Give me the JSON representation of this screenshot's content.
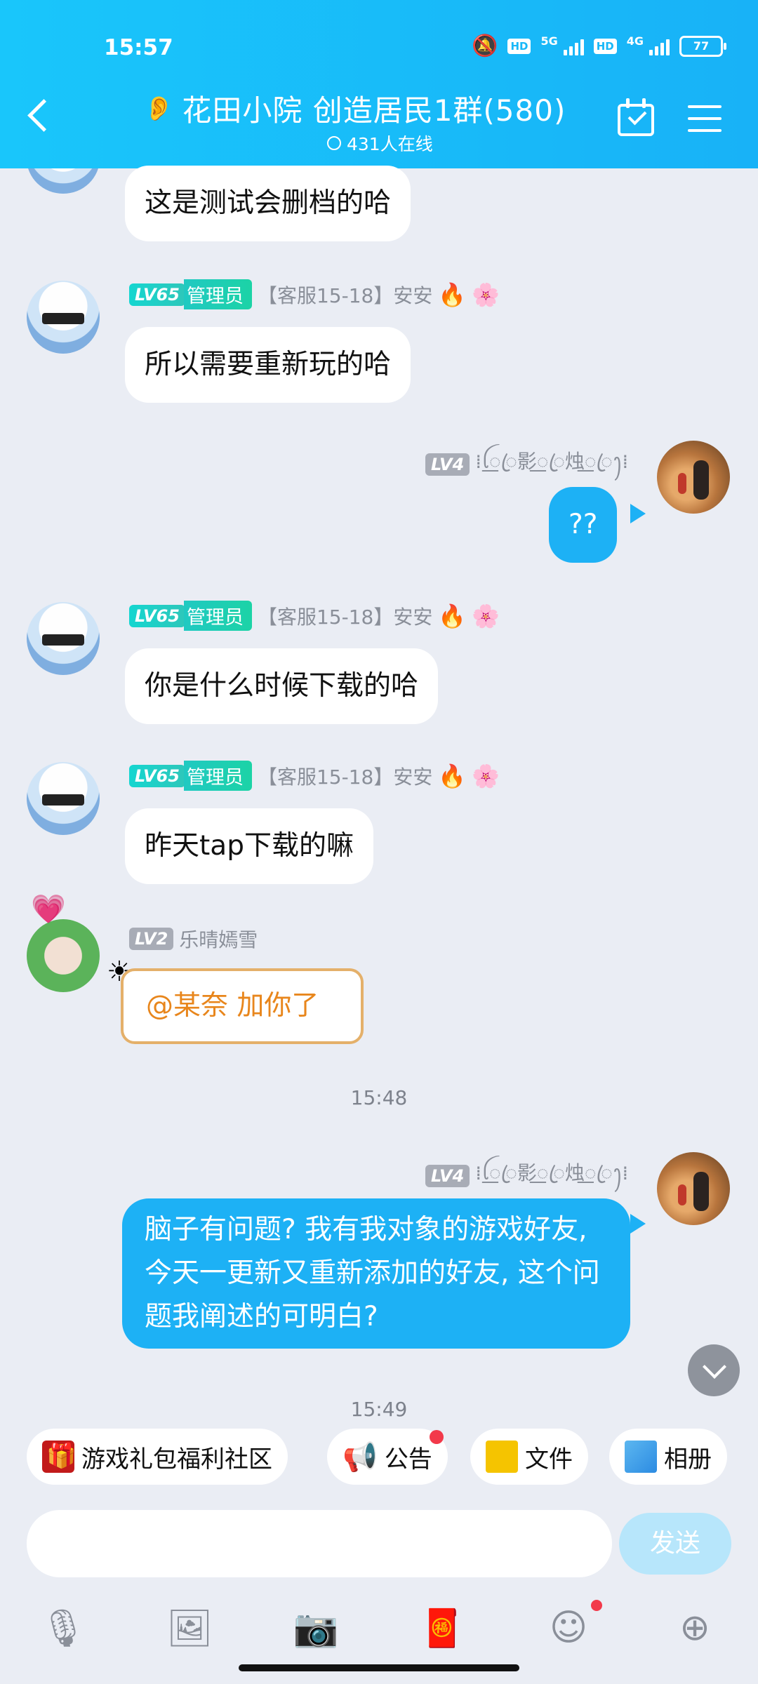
{
  "status_bar": {
    "time": "15:57",
    "network_5g": "5G",
    "network_4g": "4G",
    "hd1": "HD",
    "hd2": "HD",
    "battery": "77"
  },
  "header": {
    "title": "花田小院 创造居民1群(580)",
    "online": "431人在线"
  },
  "messages": [
    {
      "sender_side": "left",
      "text": "这是测试会删档的哈"
    },
    {
      "sender_side": "left",
      "level": "LV65",
      "role": "管理员",
      "name": "【客服15-18】安安",
      "text": "所以需要重新玩的哈"
    },
    {
      "sender_side": "right",
      "level": "LV4",
      "name": "⁞ꪶ꯭ꦿ影꯭ꦿ烛꯭ꦿꫂ⁞",
      "text": "??"
    },
    {
      "sender_side": "left",
      "level": "LV65",
      "role": "管理员",
      "name": "【客服15-18】安安",
      "text": "你是什么时候下载的哈"
    },
    {
      "sender_side": "left",
      "level": "LV65",
      "role": "管理员",
      "name": "【客服15-18】安安",
      "text": "昨天tap下载的嘛"
    },
    {
      "sender_side": "left",
      "level": "LV2",
      "name": "乐晴嫣雪",
      "text": "@某奈 加你了"
    },
    {
      "sender_side": "right",
      "level": "LV4",
      "name": "⁞ꪶ꯭ꦿ影꯭ꦿ烛꯭ꦿꫂ⁞",
      "text": "脑子有问题? 我有我对象的游戏好友, 今天一更新又重新添加的好友, 这个问题我阐述的可明白?"
    }
  ],
  "time_separators": [
    "15:48",
    "15:49"
  ],
  "shortcuts": [
    "游戏礼包福利社区",
    "公告",
    "文件",
    "相册"
  ],
  "input": {
    "placeholder": "",
    "send_label": "发送"
  },
  "toolbar_icons": [
    "microphone-icon",
    "image-icon",
    "camera-icon",
    "red-packet-icon",
    "emoji-icon",
    "plus-icon"
  ]
}
